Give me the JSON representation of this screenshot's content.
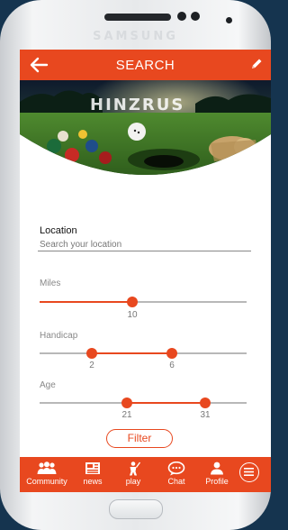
{
  "device": {
    "brand": "SAMSUNG"
  },
  "header": {
    "title": "SEARCH",
    "back_icon": "arrow-left-icon",
    "edit_icon": "pencil-icon"
  },
  "banner": {
    "logo_text": "HINZRUS"
  },
  "location": {
    "label": "Location",
    "placeholder": "Search your location",
    "value": ""
  },
  "sliders": {
    "miles": {
      "label": "Miles",
      "value": "10"
    },
    "handicap": {
      "label": "Handicap",
      "min": "2",
      "max": "6"
    },
    "age": {
      "label": "Age",
      "min": "21",
      "max": "31"
    }
  },
  "filter_label": "Filter",
  "nav": {
    "items": [
      {
        "label": "Community",
        "icon": "users-icon"
      },
      {
        "label": "news",
        "icon": "newspaper-icon"
      },
      {
        "label": "play",
        "icon": "golfer-icon"
      },
      {
        "label": "Chat",
        "icon": "chat-bubble-icon"
      },
      {
        "label": "Profile",
        "icon": "person-icon"
      }
    ],
    "menu_icon": "menu-icon"
  },
  "colors": {
    "accent": "#e8481f",
    "track": "#b8b8b8",
    "background": "#15344f"
  }
}
